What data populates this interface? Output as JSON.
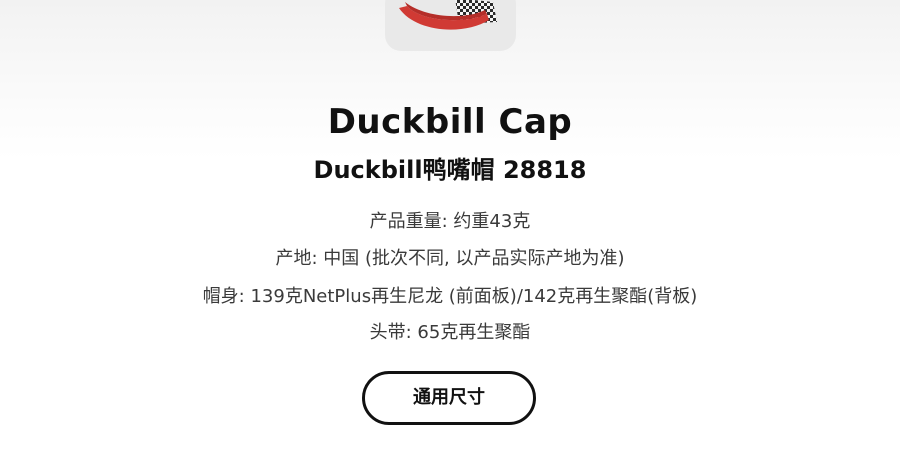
{
  "product": {
    "thumbnail_icon": "duckbill-cap-image",
    "title": "Duckbill Cap",
    "subtitle": "Duckbill鸭嘴帽 28818"
  },
  "specs": [
    "产品重量: 约重43克",
    "产地: 中国 (批次不同, 以产品实际产地为准)",
    "帽身: 139克NetPlus再生尼龙 (前面板)/142克再生聚酯(背板)",
    "头带: 65克再生聚酯"
  ],
  "size_button": {
    "label": "通用尺寸"
  },
  "colors": {
    "cap_red": "#d03a34",
    "text_dark": "#111111",
    "text_body": "#3a3a3a"
  }
}
